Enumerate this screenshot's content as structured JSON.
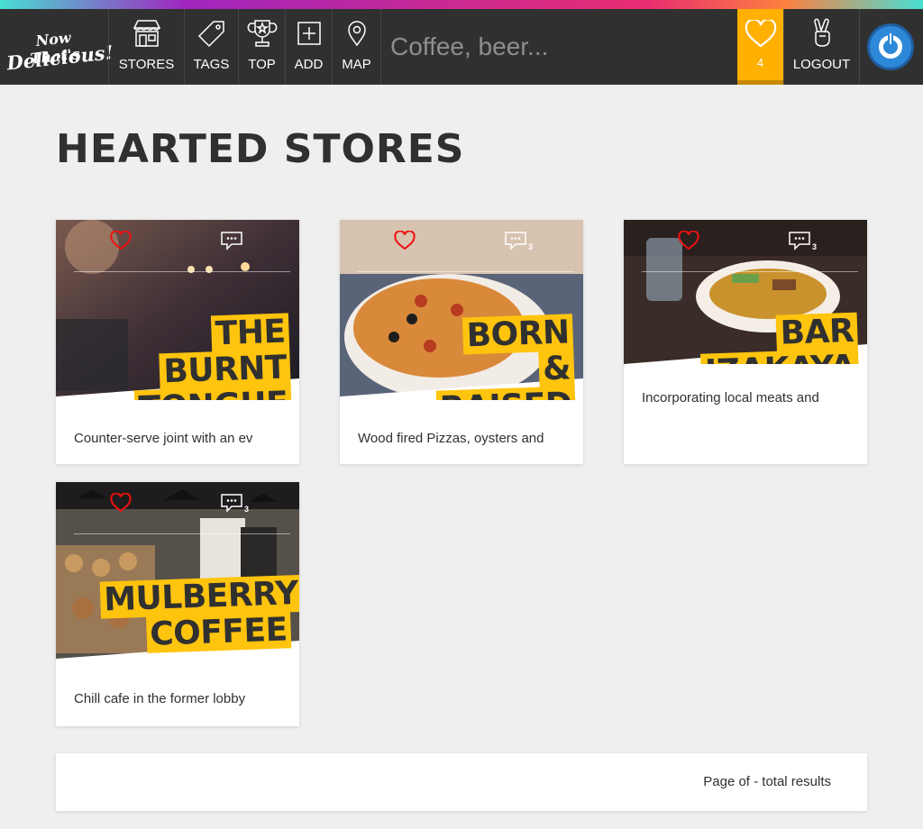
{
  "nav": {
    "logo_line1": "Now That's",
    "logo_line2": "Delicious!",
    "items": [
      {
        "label": "STORES",
        "icon": "store-icon"
      },
      {
        "label": "TAGS",
        "icon": "tag-icon"
      },
      {
        "label": "TOP",
        "icon": "trophy-icon"
      },
      {
        "label": "ADD",
        "icon": "add-icon"
      },
      {
        "label": "MAP",
        "icon": "map-pin-icon"
      }
    ],
    "search_placeholder": "Coffee, beer...",
    "hearts_count": "4",
    "logout_label": "LOGOUT",
    "accent_color": "#ffc40e"
  },
  "page": {
    "title": "HEARTED STORES"
  },
  "stores": [
    {
      "name": "THE BURNT TONGUE",
      "description": "Counter-serve joint with an ev",
      "comments": ""
    },
    {
      "name": "BORN & RAISED",
      "description": "Wood fired Pizzas, oysters and",
      "comments": "3"
    },
    {
      "name": "BAR IZAKAYA",
      "description": "Incorporating local meats and",
      "comments": "3"
    },
    {
      "name": "MULBERRY COFFEE",
      "description": "Chill cafe in the former lobby",
      "comments": "3"
    }
  ],
  "pagination": {
    "text": "Page of - total results"
  }
}
